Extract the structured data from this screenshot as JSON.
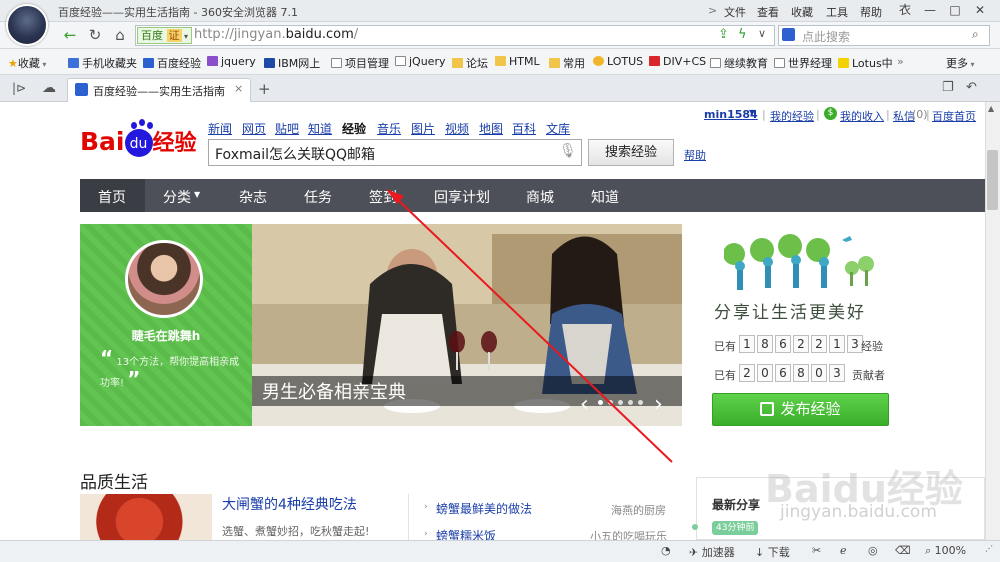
{
  "window": {
    "title": "百度经验——实用生活指南 - 360安全浏览器 7.1",
    "menu": [
      "文件",
      "查看",
      "收藏",
      "工具",
      "帮助"
    ],
    "controls": [
      "衣",
      "—",
      "□",
      "✕"
    ]
  },
  "addressbar": {
    "badge_text": "百度",
    "cert_label": "证",
    "url_prefix": "http://jingyan.",
    "url_domain": "baidu.com",
    "url_suffix": "/",
    "search_placeholder": "点此搜索"
  },
  "bookmarks": [
    {
      "label": "收藏"
    },
    {
      "label": "手机收藏夹"
    },
    {
      "label": "百度经验"
    },
    {
      "label": "jquery"
    },
    {
      "label": "IBM网上"
    },
    {
      "label": "项目管理"
    },
    {
      "label": "jQuery"
    },
    {
      "label": "论坛"
    },
    {
      "label": "HTML"
    },
    {
      "label": "常用"
    },
    {
      "label": "LOTUS"
    },
    {
      "label": "DIV+CS"
    },
    {
      "label": "继续教育"
    },
    {
      "label": "世界经理"
    },
    {
      "label": "Lotus中"
    },
    {
      "label": "更多"
    }
  ],
  "tab": {
    "title": "百度经验——实用生活指南",
    "close": "×",
    "new_tab": "+"
  },
  "site": {
    "logo_bai": "Bai",
    "logo_du": "du",
    "logo_jingyan": "经验",
    "topnav": [
      "新闻",
      "网页",
      "贴吧",
      "知道",
      "经验",
      "音乐",
      "图片",
      "视频",
      "地图",
      "百科",
      "文库"
    ],
    "search_query": "Foxmail怎么关联QQ邮箱",
    "search_button": "搜索经验",
    "help": "帮助",
    "user_links": {
      "username": "min1584",
      "my_jingyan": "我的经验",
      "my_income": "我的收入",
      "messages": "私信",
      "msg_count": "(0)",
      "baidu_home": "百度首页"
    },
    "mainnav": [
      "首页",
      "分类",
      "杂志",
      "任务",
      "签到",
      "回享计划",
      "商城",
      "知道"
    ]
  },
  "banner": {
    "author": "睫毛在跳舞h",
    "quote": "13个方法，帮你提高相亲成功率!",
    "caption": "男生必备相亲宝典"
  },
  "stats": {
    "slogan": "分享让生活更美好",
    "row1_prefix": "已有",
    "row1_digits": [
      "1",
      "8",
      "6",
      "2",
      "2",
      "1",
      "3"
    ],
    "row1_suffix": "经验",
    "row2_prefix": "已有",
    "row2_digits": [
      "2",
      "0",
      "6",
      "8",
      "0",
      "3"
    ],
    "row2_suffix": "贡献者",
    "publish_button": "发布经验"
  },
  "quality": {
    "section_title": "品质生活",
    "article_title": "大闸蟹的4种经典吃法",
    "article_desc": "选蟹、煮蟹妙招，吃秋蟹走起!",
    "list": [
      {
        "title": "螃蟹最鲜美的做法",
        "source": "海燕的厨房"
      },
      {
        "title": "螃蟹糯米饭",
        "source": "小五的吃喝玩乐"
      }
    ]
  },
  "share": {
    "title": "最新分享",
    "badge": "43分钟前"
  },
  "watermark": {
    "logo": "Baidu经验",
    "url": "jingyan.baidu.com"
  },
  "statusbar": {
    "accelerator": "加速器",
    "download": "下载",
    "zoom": "100%"
  },
  "colors": {
    "baidu_red": "#e10601",
    "baidu_blue": "#2319dc",
    "nav_bg": "#4d5058",
    "green": "#3aae2a",
    "link": "#1a3ea8",
    "annotation_arrow": "#e8191f"
  }
}
